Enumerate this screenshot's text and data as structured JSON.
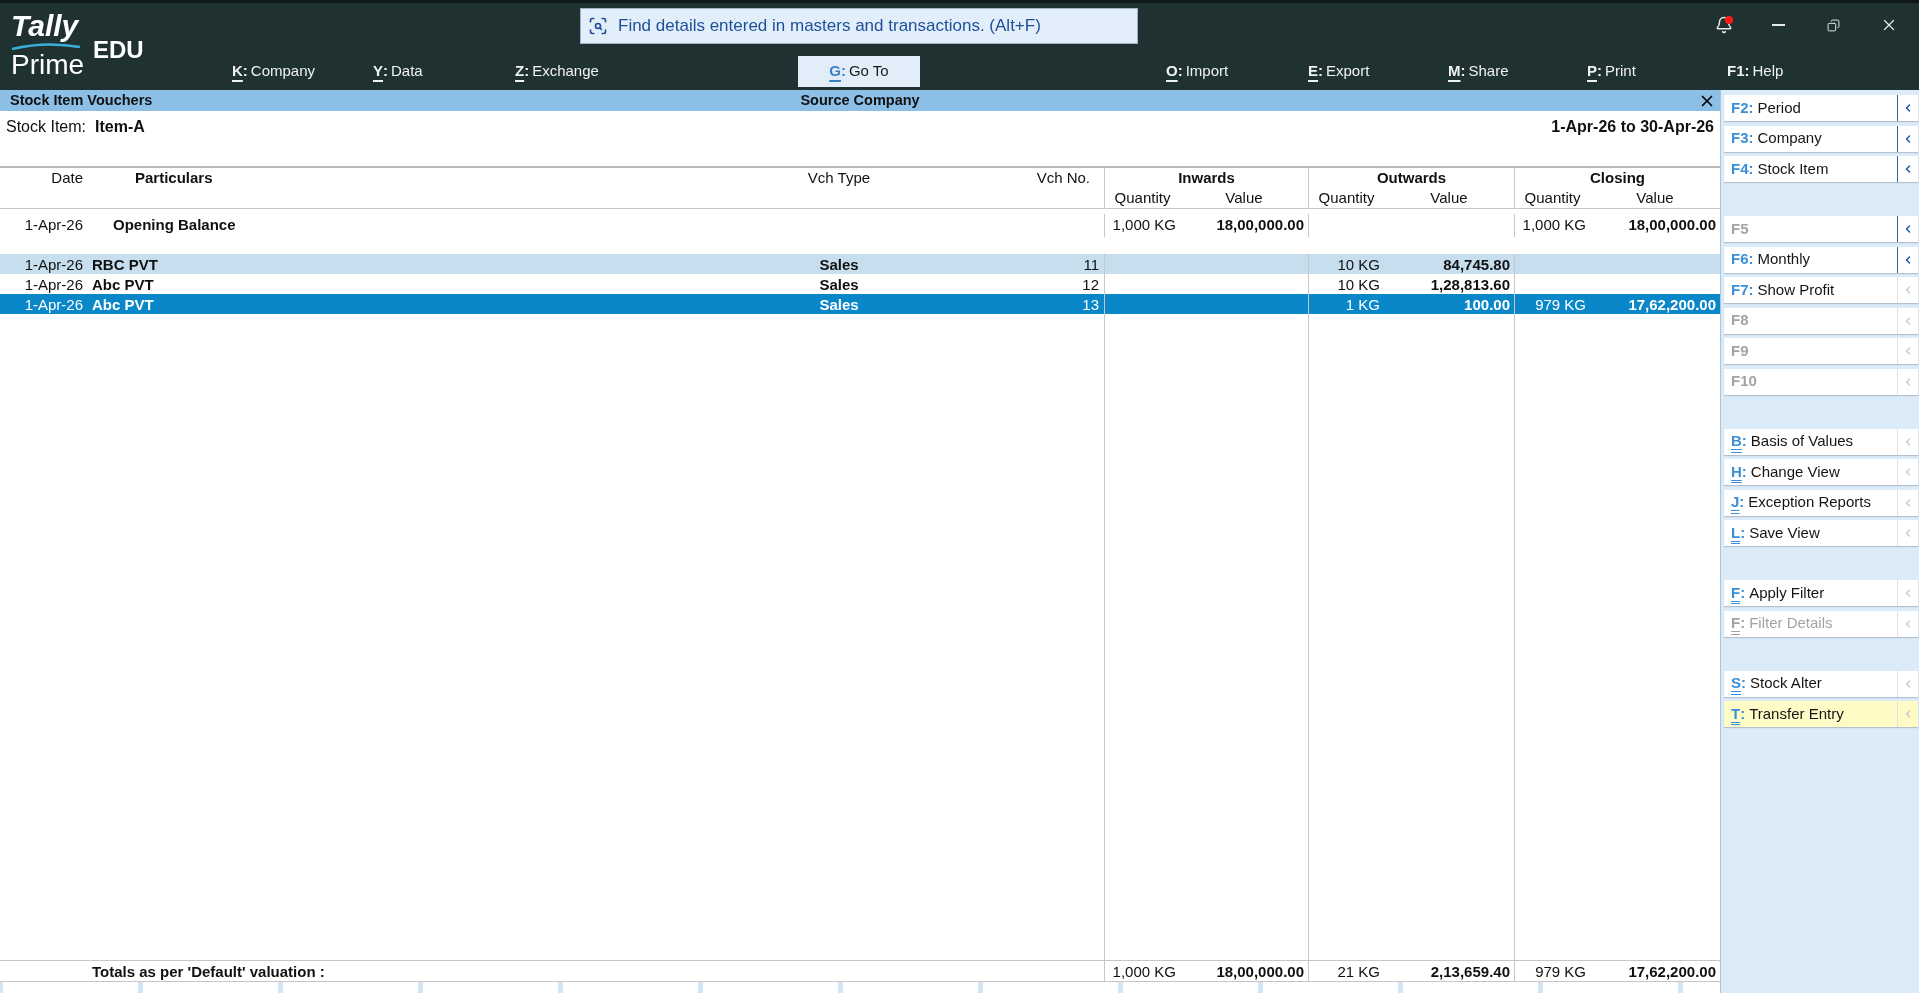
{
  "app": {
    "logo": "Tally",
    "product": "Prime",
    "edition": "EDU"
  },
  "search": {
    "placeholder": "Find details entered in masters and transactions. (Alt+F)"
  },
  "notifications": {
    "unread": true
  },
  "menu": {
    "left": [
      {
        "kind": "letter",
        "key": "K",
        "sep": ":",
        "label": "Company",
        "selected": false
      },
      {
        "kind": "letter",
        "key": "Y",
        "sep": ":",
        "label": "Data",
        "selected": false
      },
      {
        "kind": "letter",
        "key": "Z",
        "sep": ":",
        "label": "Exchange",
        "selected": false
      },
      {
        "kind": "letter",
        "key": "G",
        "sep": ":",
        "label": "Go To",
        "selected": true
      }
    ],
    "right": [
      {
        "kind": "letter",
        "key": "O",
        "sep": ":",
        "label": "Import",
        "selected": false
      },
      {
        "kind": "letter",
        "key": "E",
        "sep": ":",
        "label": "Export",
        "selected": false
      },
      {
        "kind": "letter",
        "key": "M",
        "sep": ":",
        "label": "Share",
        "selected": false
      },
      {
        "kind": "letter",
        "key": "P",
        "sep": ":",
        "label": "Print",
        "selected": false
      },
      {
        "kind": "fkey",
        "key": "F1",
        "sep": ":",
        "label": "Help",
        "selected": false
      }
    ]
  },
  "report": {
    "title": "Stock Item Vouchers",
    "company": "Source Company",
    "item_label": "Stock Item:",
    "item_value": "Item-A",
    "period": "1-Apr-26 to 30-Apr-26"
  },
  "table": {
    "columns": [
      "Date",
      "Particulars",
      "Vch Type",
      "Vch No."
    ],
    "groups": [
      {
        "label": "Inwards",
        "sub": [
          "Quantity",
          "Value"
        ]
      },
      {
        "label": "Outwards",
        "sub": [
          "Quantity",
          "Value"
        ]
      },
      {
        "label": "Closing",
        "sub": [
          "Quantity",
          "Value"
        ]
      }
    ],
    "rows": [
      {
        "kind": "opening",
        "date": "1-Apr-26",
        "particulars": "Opening Balance",
        "inwards": {
          "quantity": "1,000 KG",
          "value": "18,00,000.00"
        },
        "closing": {
          "quantity": "1,000 KG",
          "value": "18,00,000.00"
        },
        "hovered": false,
        "selected": false
      },
      {
        "kind": "voucher",
        "date": "1-Apr-26",
        "particulars": "RBC PVT",
        "vch_type": "Sales",
        "vch_no": "11",
        "outwards": {
          "quantity": "10 KG",
          "value": "84,745.80"
        },
        "hovered": true,
        "selected": false
      },
      {
        "kind": "voucher",
        "date": "1-Apr-26",
        "particulars": "Abc PVT",
        "vch_type": "Sales",
        "vch_no": "12",
        "outwards": {
          "quantity": "10 KG",
          "value": "1,28,813.60"
        },
        "hovered": false,
        "selected": false
      },
      {
        "kind": "voucher",
        "date": "1-Apr-26",
        "particulars": "Abc PVT",
        "vch_type": "Sales",
        "vch_no": "13",
        "outwards": {
          "quantity": "1 KG",
          "value": "100.00"
        },
        "closing": {
          "quantity": "979 KG",
          "value": "17,62,200.00"
        },
        "hovered": false,
        "selected": true
      }
    ],
    "totals": {
      "label": "Totals as per 'Default' valuation :",
      "inwards": {
        "quantity": "1,000 KG",
        "value": "18,00,000.00"
      },
      "outwards": {
        "quantity": "21 KG",
        "value": "2,13,659.40"
      },
      "closing": {
        "quantity": "979 KG",
        "value": "17,62,200.00"
      }
    }
  },
  "sidebar": {
    "groups": [
      {
        "items": [
          {
            "kind": "fkey",
            "key": "F2",
            "sep": ":",
            "label": "Period",
            "disabled": false,
            "has_submenu": true,
            "selected": false
          },
          {
            "kind": "fkey",
            "key": "F3",
            "sep": ":",
            "label": "Company",
            "disabled": false,
            "has_submenu": true,
            "selected": false
          },
          {
            "kind": "fkey",
            "key": "F4",
            "sep": ":",
            "label": "Stock Item",
            "disabled": false,
            "has_submenu": true,
            "selected": false
          }
        ]
      },
      {
        "items": [
          {
            "kind": "fkey",
            "key": "F5",
            "disabled": true,
            "has_submenu": true,
            "selected": false
          },
          {
            "kind": "fkey",
            "key": "F6",
            "sep": ":",
            "label": "Monthly",
            "disabled": false,
            "has_submenu": true,
            "selected": false
          },
          {
            "kind": "fkey",
            "key": "F7",
            "sep": ":",
            "label": "Show Profit",
            "disabled": false,
            "has_submenu": false,
            "selected": false
          },
          {
            "kind": "fkey",
            "key": "F8",
            "disabled": true,
            "has_submenu": false,
            "selected": false
          },
          {
            "kind": "fkey",
            "key": "F9",
            "disabled": true,
            "has_submenu": false,
            "selected": false
          },
          {
            "kind": "fkey",
            "key": "F10",
            "disabled": true,
            "has_submenu": false,
            "selected": false
          }
        ]
      },
      {
        "items": [
          {
            "kind": "letter",
            "key": "B",
            "sep": ":",
            "label": "Basis of Values",
            "disabled": false,
            "has_submenu": false,
            "selected": false
          },
          {
            "kind": "letter",
            "key": "H",
            "sep": ":",
            "label": "Change View",
            "disabled": false,
            "has_submenu": false,
            "selected": false
          },
          {
            "kind": "letter",
            "key": "J",
            "sep": ":",
            "label": "Exception Reports",
            "disabled": false,
            "has_submenu": false,
            "selected": false
          },
          {
            "kind": "letter",
            "key": "L",
            "sep": ":",
            "label": "Save View",
            "disabled": false,
            "has_submenu": false,
            "selected": false
          }
        ]
      },
      {
        "items": [
          {
            "kind": "letter",
            "key": "F",
            "sep": ":",
            "label": "Apply Filter",
            "disabled": false,
            "has_submenu": false,
            "selected": false
          },
          {
            "kind": "letter",
            "key": "F",
            "sep": ":",
            "label": "Filter Details",
            "disabled": true,
            "has_submenu": false,
            "selected": false
          }
        ]
      },
      {
        "items": [
          {
            "kind": "letter",
            "key": "S",
            "sep": ":",
            "label": "Stock Alter",
            "disabled": false,
            "has_submenu": false,
            "selected": false
          },
          {
            "kind": "letter",
            "key": "T",
            "sep": ":",
            "label": "Transfer Entry",
            "disabled": false,
            "has_submenu": false,
            "selected": true
          }
        ]
      }
    ]
  }
}
